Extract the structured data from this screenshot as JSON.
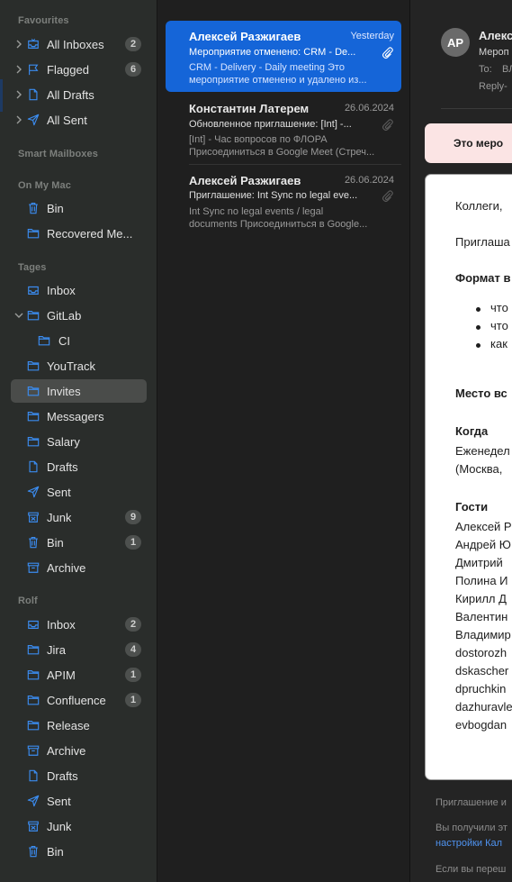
{
  "sidebar": {
    "sections": {
      "favourites": "Favourites",
      "smart": "Smart Mailboxes",
      "on_my_mac": "On My Mac",
      "tages": "Tages",
      "rolf": "Rolf"
    },
    "favourites": [
      {
        "label": "All Inboxes",
        "badge": "2",
        "icon": "inbox-icon"
      },
      {
        "label": "Flagged",
        "badge": "6",
        "icon": "flag-icon"
      },
      {
        "label": "All Drafts",
        "badge": "",
        "icon": "document-icon"
      },
      {
        "label": "All Sent",
        "badge": "",
        "icon": "paperplane-icon"
      }
    ],
    "on_my_mac": [
      {
        "label": "Bin",
        "badge": "",
        "icon": "trash-icon"
      },
      {
        "label": "Recovered Me...",
        "badge": "",
        "icon": "folder-icon"
      }
    ],
    "tages": [
      {
        "label": "Inbox",
        "badge": "",
        "icon": "inbox-icon"
      },
      {
        "label": "GitLab",
        "badge": "",
        "icon": "folder-icon"
      },
      {
        "label": "CI",
        "badge": "",
        "icon": "folder-icon"
      },
      {
        "label": "YouTrack",
        "badge": "",
        "icon": "folder-icon"
      },
      {
        "label": "Invites",
        "badge": "",
        "icon": "folder-icon"
      },
      {
        "label": "Messagers",
        "badge": "",
        "icon": "folder-icon"
      },
      {
        "label": "Salary",
        "badge": "",
        "icon": "folder-icon"
      },
      {
        "label": "Drafts",
        "badge": "",
        "icon": "document-icon"
      },
      {
        "label": "Sent",
        "badge": "",
        "icon": "paperplane-icon"
      },
      {
        "label": "Junk",
        "badge": "9",
        "icon": "junk-icon"
      },
      {
        "label": "Bin",
        "badge": "1",
        "icon": "trash-icon"
      },
      {
        "label": "Archive",
        "badge": "",
        "icon": "archive-icon"
      }
    ],
    "rolf": [
      {
        "label": "Inbox",
        "badge": "2",
        "icon": "inbox-icon"
      },
      {
        "label": "Jira",
        "badge": "4",
        "icon": "folder-icon"
      },
      {
        "label": "APIM",
        "badge": "1",
        "icon": "folder-icon"
      },
      {
        "label": "Confluence",
        "badge": "1",
        "icon": "folder-icon"
      },
      {
        "label": "Release",
        "badge": "",
        "icon": "folder-icon"
      },
      {
        "label": "Archive",
        "badge": "",
        "icon": "archive-icon"
      },
      {
        "label": "Drafts",
        "badge": "",
        "icon": "document-icon"
      },
      {
        "label": "Sent",
        "badge": "",
        "icon": "paperplane-icon"
      },
      {
        "label": "Junk",
        "badge": "",
        "icon": "junk-icon"
      },
      {
        "label": "Bin",
        "badge": "",
        "icon": "trash-icon"
      }
    ]
  },
  "messages": [
    {
      "from": "Алексей Разжигаев",
      "date": "Yesterday",
      "subject": "Мероприятие отменено: CRM - De...",
      "preview1": "CRM - Delivery - Daily meeting Это",
      "preview2": "мероприятие отменено и удалено из...",
      "selected": true
    },
    {
      "from": "Константин Латерем",
      "date": "26.06.2024",
      "subject": "Обновленное приглашение: [Int] -...",
      "preview1": "[Int] - Час вопросов по ФЛОРА",
      "preview2": "Присоединиться в Google Meet (Стреч...",
      "selected": false
    },
    {
      "from": "Алексей Разжигаев",
      "date": "26.06.2024",
      "subject": "Приглашение: Int Sync no legal eve...",
      "preview1": "Int Sync no legal events / legal",
      "preview2": "documents Присоединиться в Google...",
      "selected": false
    }
  ],
  "reader": {
    "avatar_initials": "AP",
    "from_name": "Алекс",
    "subject": "Мероп",
    "to_label": "To:",
    "to_value": "ВЛ",
    "reply_to": "Reply-",
    "banner": "Это меро",
    "body": {
      "greeting": "Коллеги,",
      "intro": "Приглаша",
      "format_head": "Формат в",
      "bullets": [
        "что",
        "что",
        "как"
      ],
      "place_head": "Место вс",
      "when_head": "Когда",
      "when_line1": "Еженедел",
      "when_line2": "(Москва,",
      "guests_head": "Гости",
      "guests": [
        "Алексей Р",
        "Андрей Ю",
        "Дмитрий",
        "Полина И",
        "Кирилл Д",
        "Валентин",
        "Владимир",
        "dostorozh",
        "dskascher",
        "dpruchkin",
        "dazhuravle",
        "evbogdan"
      ]
    },
    "footer": {
      "line1": "Приглашение и",
      "line2": "Вы получили эт",
      "line3_link": "настройки Кал",
      "line4": "Если вы переш"
    }
  },
  "colors": {
    "accent": "#1565d8",
    "icon_blue": "#3b8cf0",
    "sidebar_bg": "#2a2d2b"
  }
}
